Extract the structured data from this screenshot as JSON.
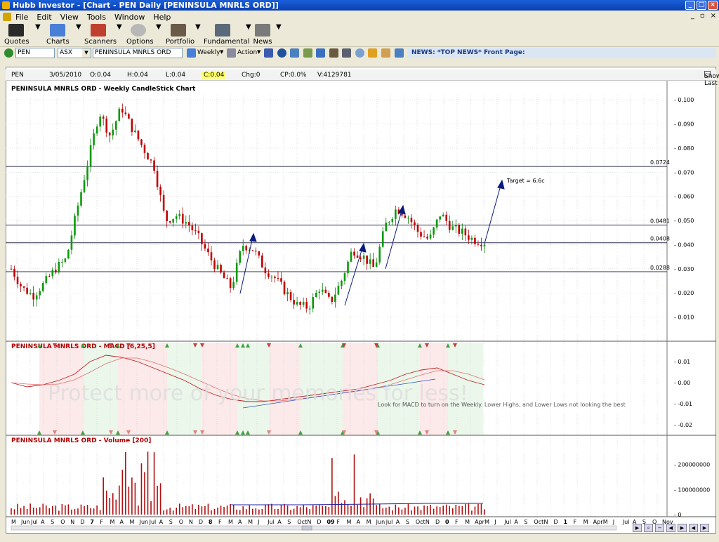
{
  "window": {
    "title": "Hubb Investor - [Chart - PEN Daily [PENINSULA MNRLS ORD]]"
  },
  "menu": {
    "items": [
      "File",
      "Edit",
      "View",
      "Tools",
      "Window",
      "Help"
    ]
  },
  "toolbar": {
    "buttons": [
      {
        "label": "Quotes",
        "icon": "quotes-icon"
      },
      {
        "label": "Charts",
        "icon": "charts-icon"
      },
      {
        "label": "Scanners",
        "icon": "scanners-icon"
      },
      {
        "label": "Options",
        "icon": "options-icon"
      },
      {
        "label": "Portfolio",
        "icon": "portfolio-icon"
      },
      {
        "label": "Fundamental",
        "icon": "fundamental-icon"
      },
      {
        "label": "News",
        "icon": "news-icon"
      }
    ]
  },
  "toolbar2": {
    "code": "PEN",
    "exchange": "ASX",
    "name": "PENINSULA MNRLS ORD",
    "period": "Weekly",
    "action": "Action",
    "news": "NEWS: *TOP NEWS* Front Page:"
  },
  "info": {
    "code": "PEN",
    "date": "3/05/2010",
    "open": "O:0.04",
    "high": "H:0.04",
    "low": "L:0.04",
    "close": "C:0.04",
    "chg": "Chg:0",
    "cp": "CP:0.0%",
    "volume": "V:4129781",
    "show_last": "Show Last"
  },
  "chart_data": [
    {
      "type": "candlestick",
      "title": "PENINSULA MNRLS ORD - Weekly CandleStick Chart",
      "ylim": [
        0.0,
        0.105
      ],
      "yticks": [
        "0.100",
        "0.090",
        "0.080",
        "0.070",
        "0.060",
        "0.050",
        "0.040",
        "0.030",
        "0.020",
        "0.010"
      ],
      "horizontal_lines": [
        {
          "value": 0.0724,
          "label": "0.0724"
        },
        {
          "value": 0.0481,
          "label": "0.0481"
        },
        {
          "value": 0.0408,
          "label": "0.0408"
        },
        {
          "value": 0.0288,
          "label": "0.0288"
        }
      ],
      "annotation": "Target = 6.6c",
      "close_path": [
        0.03,
        0.022,
        0.019,
        0.024,
        0.03,
        0.034,
        0.055,
        0.075,
        0.095,
        0.085,
        0.097,
        0.088,
        0.08,
        0.072,
        0.05,
        0.052,
        0.049,
        0.043,
        0.035,
        0.028,
        0.022,
        0.04,
        0.038,
        0.03,
        0.026,
        0.02,
        0.015,
        0.014,
        0.022,
        0.016,
        0.025,
        0.038,
        0.035,
        0.03,
        0.048,
        0.055,
        0.052,
        0.045,
        0.042,
        0.053,
        0.047,
        0.045,
        0.042,
        0.041
      ]
    },
    {
      "type": "line",
      "title": "PENINSULA MNRLS ORD - MACD [6,25,5]",
      "ylim": [
        -0.025,
        0.015
      ],
      "yticks": [
        "0.01",
        "0.00",
        "-0.01",
        "-0.02"
      ],
      "annotation": "Look for MACD to turn on the Weekly. Lower Highs, and Lower Lows not looking the best",
      "watermark": "Protect more of your memories for less!"
    },
    {
      "type": "bar",
      "title": "PENINSULA MNRLS ORD - Volume [200]",
      "ylim": [
        0,
        280000000
      ],
      "yticks": [
        "200000000",
        "100000000",
        "0"
      ]
    }
  ],
  "xaxis": {
    "labels": [
      "M",
      "Jun",
      "Jul",
      "A",
      "S",
      "O",
      "N",
      "D",
      "7",
      "F",
      "M",
      "A",
      "M",
      "Jun",
      "Jul",
      "A",
      "S",
      "O",
      "N",
      "D",
      "8",
      "F",
      "M",
      "A",
      "M",
      "J",
      "Jul",
      "A",
      "S",
      "Oct",
      "N",
      "D",
      "09",
      "F",
      "M",
      "A",
      "M",
      "Jun",
      "Jul",
      "A",
      "S",
      "Oct",
      "N",
      "D",
      "0",
      "F",
      "M",
      "Apr",
      "M",
      "J",
      "Jul",
      "A",
      "S",
      "Oct",
      "N",
      "D",
      "1",
      "F",
      "M",
      "Apr",
      "M",
      "J",
      "Jul",
      "A",
      "S",
      "O",
      "Nov"
    ]
  }
}
